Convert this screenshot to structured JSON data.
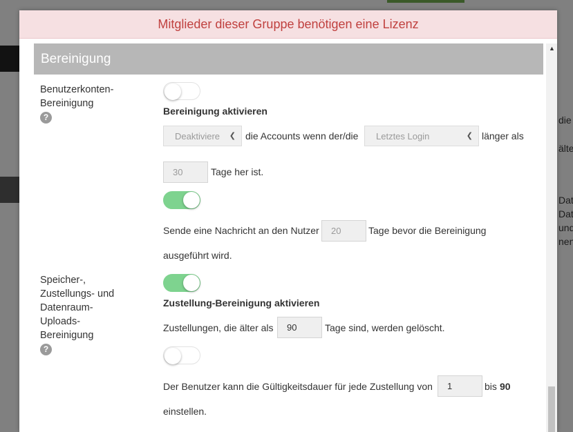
{
  "background": {
    "right_fragments": [
      "die",
      "älter",
      "Daten",
      "Daten",
      "und",
      "nen"
    ]
  },
  "modal": {
    "license_banner": "Mitglieder dieser Gruppe benötigen eine Lizenz",
    "section_title": "Bereinigung",
    "account_cleanup": {
      "label_line1": "Benutzerkonten-",
      "label_line2": "Bereinigung",
      "help_symbol": "?",
      "enable_toggle": false,
      "enable_label": "Bereinigung aktivieren",
      "action_select": "Deaktiviere",
      "text_accounts_when": "die Accounts wenn der/die",
      "criterion_select": "Letztes Login",
      "text_longer_than": "länger als",
      "days_value": "30",
      "text_days_ago": "Tage her ist.",
      "notify_toggle": true,
      "notify_text_before": "Sende eine Nachricht an den Nutzer",
      "notify_days": "20",
      "notify_text_after": "Tage bevor die Bereinigung",
      "notify_text_line2": "ausgeführt wird."
    },
    "delivery_cleanup": {
      "label_lines": [
        "Speicher-,",
        "Zustellungs- und",
        "Datenraum-",
        "Uploads-",
        "Bereinigung"
      ],
      "help_symbol": "?",
      "enable_toggle": true,
      "enable_label": "Zustellung-Bereinigung aktivieren",
      "text_older_than": "Zustellungen, die älter als",
      "days_value": "90",
      "text_deleted": "Tage sind, werden gelöscht.",
      "validity_toggle": false,
      "validity_text": "Der Benutzer kann die Gültigkeitsdauer für jede Zustellung von",
      "validity_min": "1",
      "text_to": "bis",
      "validity_max": "90",
      "text_set": "einstellen."
    }
  },
  "colors": {
    "banner_bg": "#f6e0e2",
    "banner_text": "#c0413f",
    "section_header_bg": "#b7b7b7",
    "toggle_on": "#7ed38f"
  }
}
